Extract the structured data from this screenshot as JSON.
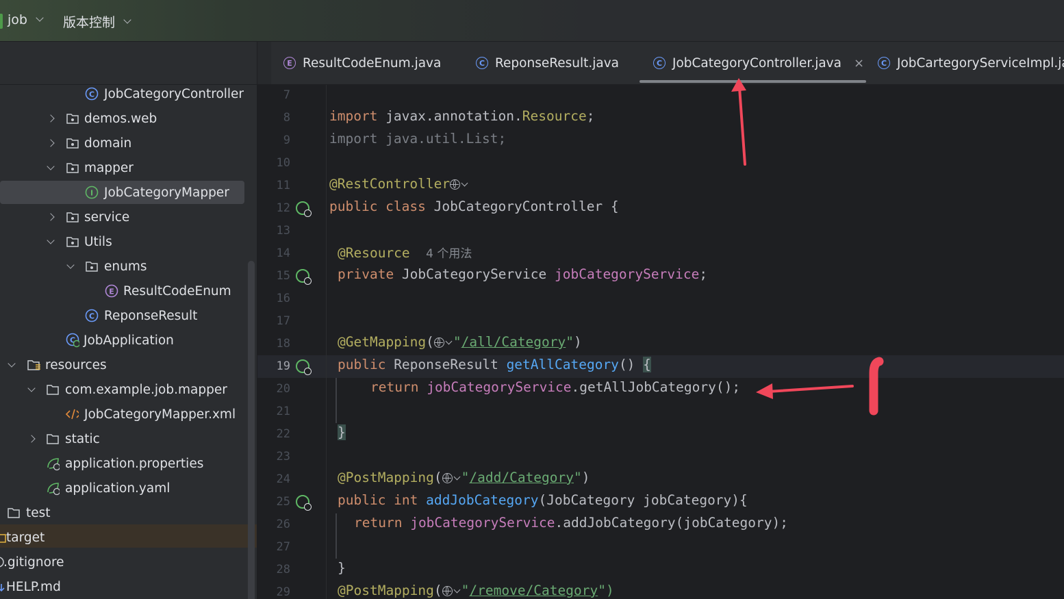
{
  "topbar": {
    "project_name": "job",
    "vcs_menu": "版本控制"
  },
  "tree": {
    "items": [
      {
        "label": "JobCategoryController",
        "icon": "class-icon"
      },
      {
        "label": "demos.web",
        "icon": "package-icon"
      },
      {
        "label": "domain",
        "icon": "package-icon"
      },
      {
        "label": "mapper",
        "icon": "package-icon"
      },
      {
        "label": "JobCategoryMapper",
        "icon": "interface-icon"
      },
      {
        "label": "service",
        "icon": "package-icon"
      },
      {
        "label": "Utils",
        "icon": "package-icon"
      },
      {
        "label": "enums",
        "icon": "package-icon"
      },
      {
        "label": "ResultCodeEnum",
        "icon": "enum-icon"
      },
      {
        "label": "ReponseResult",
        "icon": "class-icon"
      },
      {
        "label": "JobApplication",
        "icon": "spring-app-icon"
      },
      {
        "label": "resources",
        "icon": "resources-folder-icon"
      },
      {
        "label": "com.example.job.mapper",
        "icon": "folder-icon"
      },
      {
        "label": "JobCategoryMapper.xml",
        "icon": "xml-icon"
      },
      {
        "label": "static",
        "icon": "folder-icon"
      },
      {
        "label": "application.properties",
        "icon": "spring-config-icon"
      },
      {
        "label": "application.yaml",
        "icon": "spring-config-icon"
      },
      {
        "label": "test",
        "icon": "folder-icon"
      },
      {
        "label": "target",
        "icon": "folder-icon"
      },
      {
        "label": ".gitignore",
        "icon": "file-icon"
      },
      {
        "label": "HELP.md",
        "icon": "markdown-icon"
      }
    ]
  },
  "tabs": [
    {
      "label": "ResultCodeEnum.java",
      "icon": "E"
    },
    {
      "label": "ReponseResult.java",
      "icon": "C"
    },
    {
      "label": "JobCategoryController.java",
      "icon": "C",
      "active": true,
      "close": "×"
    },
    {
      "label": "JobCartegoryServiceImpl.java",
      "icon": "C"
    }
  ],
  "editor": {
    "line_numbers": [
      "7",
      "8",
      "9",
      "10",
      "11",
      "12",
      "13",
      "14",
      "15",
      "16",
      "17",
      "18",
      "19",
      "20",
      "21",
      "22",
      "23",
      "24",
      "25",
      "26",
      "27",
      "28",
      "29"
    ],
    "current_line": "19",
    "code": {
      "l8_kw": "import",
      "l8_pkg": " javax.annotation.",
      "l8_cls": "Resource",
      "l8_end": ";",
      "l9": "import java.util.List;",
      "l11": "@RestController",
      "l12_kw": "public class",
      "l12_rest": " JobCategoryController {",
      "l14_ann": "@Resource",
      "l14_hint": "4 个用法",
      "l15_kw": "private",
      "l15_type": " JobCategoryService ",
      "l15_fld": "jobCategoryService",
      "l15_end": ";",
      "l18_ann": "@GetMapping",
      "l18_open": "(",
      "l18_q1": "\"",
      "l18_path": "/all/Category",
      "l18_q2": "\"",
      "l18_close": ")",
      "l19_kw": "public",
      "l19_type": " ReponseResult ",
      "l19_fn": "getAllCategory",
      "l19_paren": "() ",
      "l19_brace": "{",
      "l20_kw": "return",
      "l20_sp": " ",
      "l20_fld": "jobCategoryService",
      "l20_call": ".getAllJobCategory();",
      "l22": "}",
      "l24_ann": "@PostMapping",
      "l24_open": "(",
      "l24_q1": "\"",
      "l24_path": "/add/Category",
      "l24_q2": "\"",
      "l24_close": ")",
      "l25_kw": "public int",
      "l25_sp": " ",
      "l25_fn": "addJobCategory",
      "l25_rest": "(JobCategory jobCategory){",
      "l26_kw": "return",
      "l26_sp": " ",
      "l26_fld": "jobCategoryService",
      "l26_call": ".addJobCategory(jobCategory);",
      "l28": "}",
      "l29_ann": "@PostMapping",
      "l29_open": "(",
      "l29_q1": "\"",
      "l29_path": "/remove/Category",
      "l29_q2": "\")"
    }
  },
  "colors": {
    "keyword": "#cf8e6d",
    "annotation": "#b3ae60",
    "method": "#56a8f5",
    "field": "#c77dbb",
    "string": "#6aab73",
    "annotation_arrow": "#f0475a"
  }
}
